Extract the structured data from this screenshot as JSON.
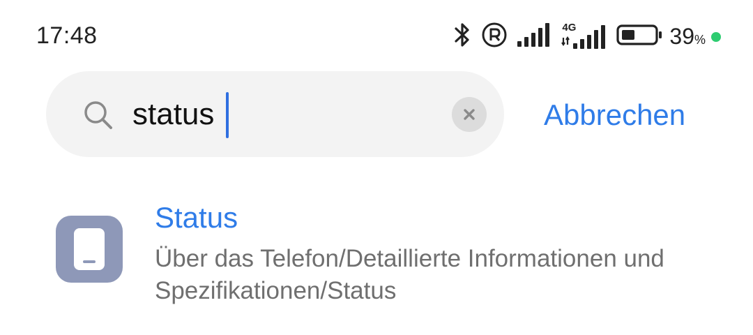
{
  "status_bar": {
    "time": "17:48",
    "network_label": "4G",
    "battery_percent": "39",
    "battery_unit": "%",
    "battery_level": 0.39,
    "icons": [
      "bluetooth-icon",
      "registered-icon",
      "signal-icon",
      "4g-signal-icon",
      "battery-icon",
      "charging-dot-icon"
    ],
    "dot_color": "#2ecc71"
  },
  "search": {
    "value": "status",
    "cancel_label": "Abbrechen",
    "accent_color": "#2f7ce8"
  },
  "results": [
    {
      "title": "Status",
      "path": "Über das Telefon/Detaillierte Informationen und Spezifikationen/Status",
      "icon": "phone-icon",
      "icon_color": "#8e98b8"
    }
  ]
}
